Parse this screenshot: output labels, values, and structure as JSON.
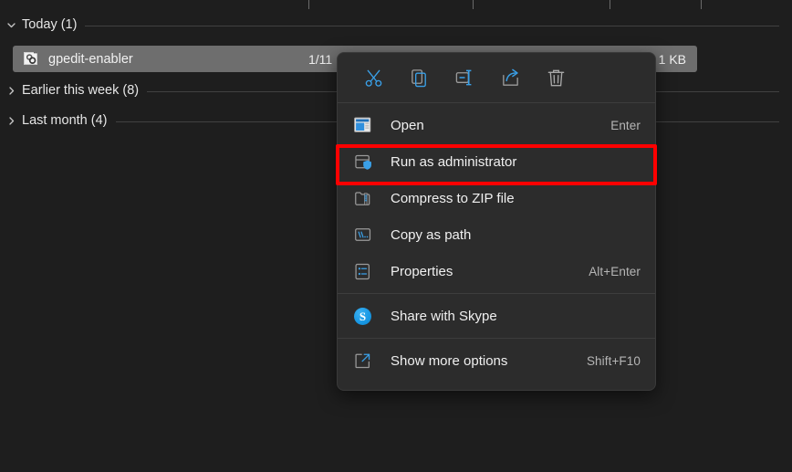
{
  "window": {
    "background_color": "#1e1e1e"
  },
  "file_list": {
    "groups": [
      {
        "label": "Today (1)",
        "expanded": true,
        "chevron": "chevron-down-icon"
      },
      {
        "label": "Earlier this week (8)",
        "expanded": false,
        "chevron": "chevron-right-icon"
      },
      {
        "label": "Last month (4)",
        "expanded": false,
        "chevron": "chevron-right-icon"
      }
    ],
    "selected_row": {
      "icon": "batch-script-file-icon",
      "name": "gpedit-enabler",
      "date": "1/11",
      "size": "1 KB",
      "selected": true,
      "highlight_color": "#6e6e6e"
    }
  },
  "context_menu": {
    "toolbar": [
      {
        "name": "cut-icon",
        "label": "Cut"
      },
      {
        "name": "copy-icon",
        "label": "Copy"
      },
      {
        "name": "rename-icon",
        "label": "Rename"
      },
      {
        "name": "share-icon",
        "label": "Share"
      },
      {
        "name": "delete-icon",
        "label": "Delete"
      }
    ],
    "items": [
      {
        "icon": "open-window-icon",
        "label": "Open",
        "shortcut": "Enter",
        "highlighted": false
      },
      {
        "icon": "shield-run-admin-icon",
        "label": "Run as administrator",
        "shortcut": "",
        "highlighted": true
      },
      {
        "icon": "zip-folder-icon",
        "label": "Compress to ZIP file",
        "shortcut": "",
        "highlighted": false
      },
      {
        "icon": "copy-as-path-icon",
        "label": "Copy as path",
        "shortcut": "",
        "highlighted": false
      },
      {
        "icon": "properties-icon",
        "label": "Properties",
        "shortcut": "Alt+Enter",
        "highlighted": false
      },
      {
        "icon": "skype-icon",
        "label": "Share with Skype",
        "shortcut": "",
        "highlighted": false
      },
      {
        "icon": "show-more-options-icon",
        "label": "Show more options",
        "shortcut": "Shift+F10",
        "highlighted": false
      }
    ]
  },
  "annotation": {
    "target_label": "Run as administrator",
    "box_color": "#fe0000"
  },
  "colors": {
    "accent_blue": "#3aa0e8",
    "menu_background": "#2c2c2c",
    "text_primary": "#f0f0f0",
    "text_secondary": "#b6b6b6"
  }
}
